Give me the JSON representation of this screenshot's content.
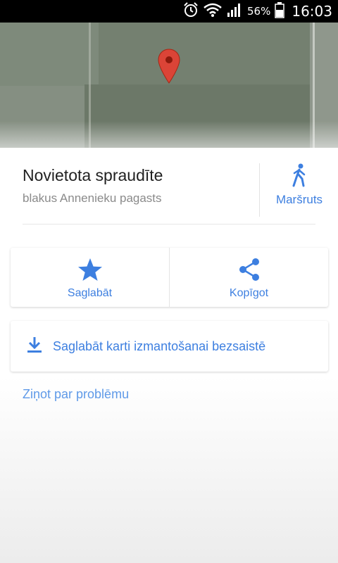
{
  "status_bar": {
    "icons": [
      "alarm-clock-icon",
      "wifi-icon",
      "signal-icon",
      "battery-icon"
    ],
    "battery_percent": "56%",
    "time": "16:03"
  },
  "map": {
    "pin_color": "#db4437"
  },
  "place": {
    "title": "Novietota spraudīte",
    "subtitle": "blakus Annenieku pagasts"
  },
  "route": {
    "label": "Maršruts",
    "icon": "walking-person-icon"
  },
  "actions": [
    {
      "label": "Saglabāt",
      "icon": "star-icon"
    },
    {
      "label": "Kopīgot",
      "icon": "share-icon"
    }
  ],
  "offline": {
    "label": "Saglabāt karti izmantošanai bezsaistē",
    "icon": "download-icon"
  },
  "report": {
    "label": "Ziņot par problēmu"
  },
  "colors": {
    "accent": "#3d7fe0",
    "title_text": "#212121",
    "subtitle_text": "#8a8a8a"
  }
}
